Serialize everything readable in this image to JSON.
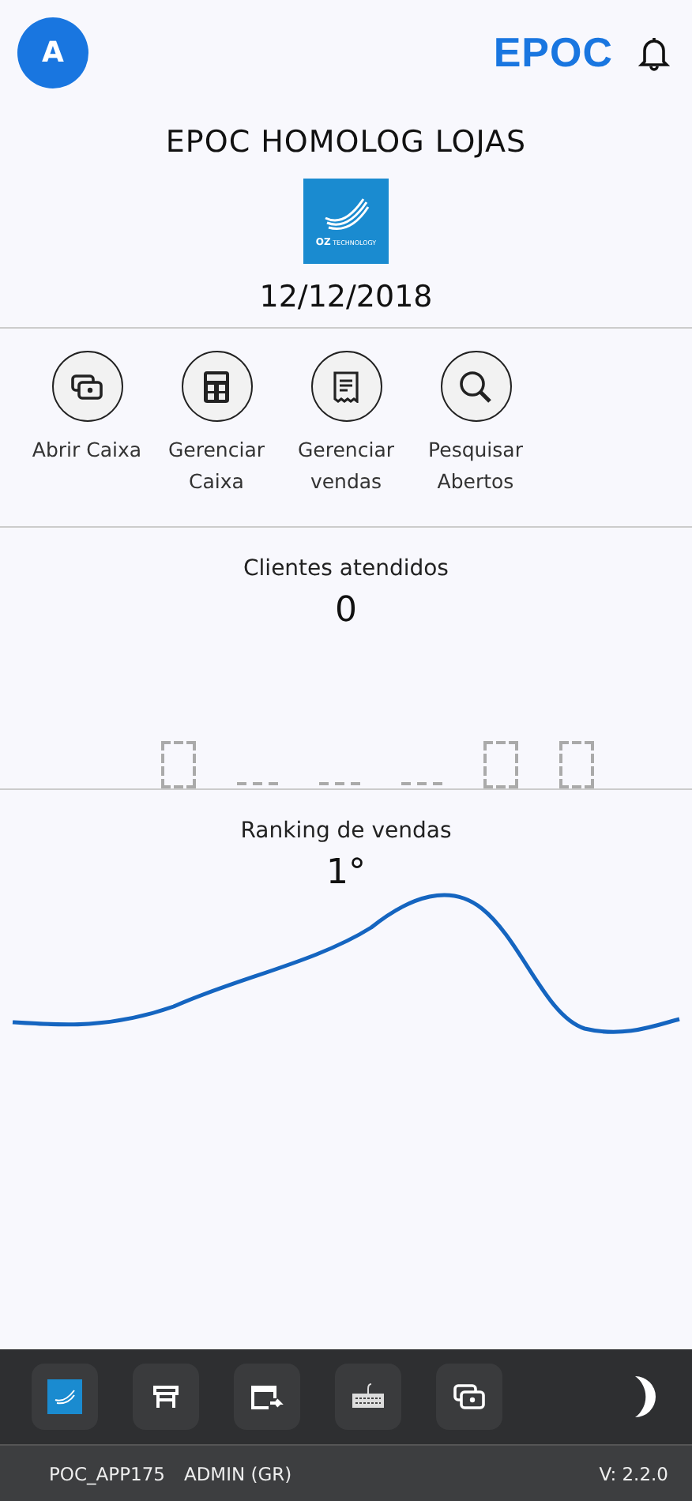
{
  "header": {
    "avatar": "A",
    "brand": "EPOC"
  },
  "store": {
    "name": "EPOC HOMOLOG LOJAS",
    "logo": {
      "mark": "OZ",
      "text": "TECHNOLOGY"
    },
    "date": "12/12/2018"
  },
  "actions": [
    {
      "label": "Abrir Caixa"
    },
    {
      "label": "Gerenciar Caixa"
    },
    {
      "label": "Gerenciar vendas"
    },
    {
      "label": "Pesquisar Abertos"
    }
  ],
  "clients": {
    "title": "Clientes atendidos",
    "value": "0",
    "placeholders": [
      {
        "kind": "box"
      },
      {
        "kind": "dash"
      },
      {
        "kind": "dash"
      },
      {
        "kind": "dash"
      },
      {
        "kind": "box"
      },
      {
        "kind": "box"
      }
    ]
  },
  "ranking": {
    "title": "Ranking de vendas",
    "value": "1°"
  },
  "status_bar": {
    "device": "POC_APP175",
    "user": "ADMIN (GR)",
    "version": "V: 2.2.0"
  }
}
